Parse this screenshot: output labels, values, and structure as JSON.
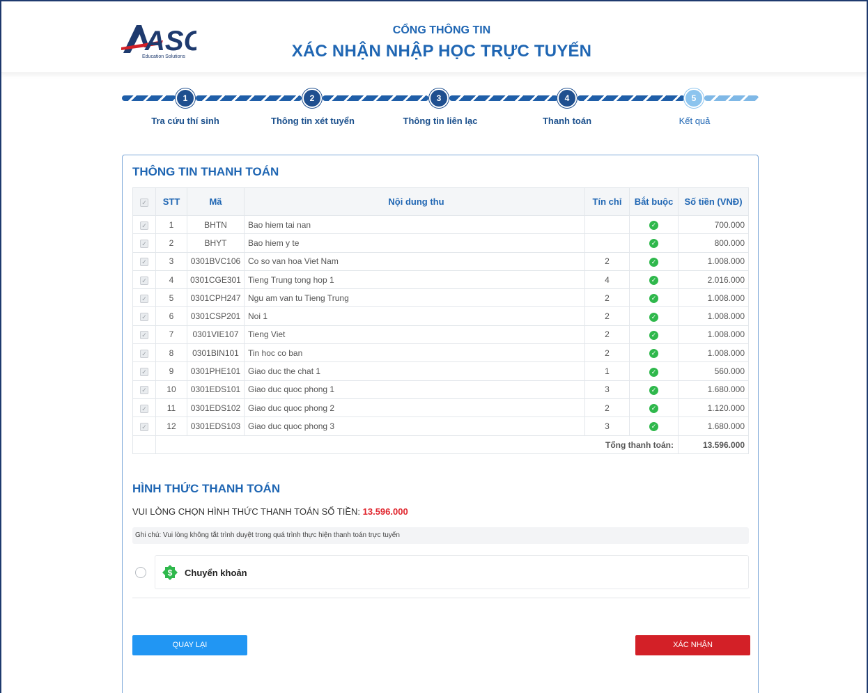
{
  "header": {
    "logo_text": "ASC",
    "logo_sub": "Education Solutions",
    "title_small": "CỔNG THÔNG TIN",
    "title_large": "XÁC NHẬN NHẬP HỌC TRỰC TUYẾN"
  },
  "steps": [
    {
      "num": "1",
      "label": "Tra cứu thí sinh",
      "state": "done"
    },
    {
      "num": "2",
      "label": "Thông tin xét tuyển",
      "state": "done"
    },
    {
      "num": "3",
      "label": "Thông tin liên lạc",
      "state": "done"
    },
    {
      "num": "4",
      "label": "Thanh toán",
      "state": "current"
    },
    {
      "num": "5",
      "label": "Kết quả",
      "state": "pending"
    }
  ],
  "payment_info": {
    "title": "THÔNG TIN THANH TOÁN",
    "columns": {
      "stt": "STT",
      "ma": "Mã",
      "noi_dung": "Nội dung thu",
      "tin_chi": "Tín chỉ",
      "bat_buoc": "Bắt buộc",
      "so_tien": "Số tiền (VNĐ)"
    },
    "rows": [
      {
        "stt": "1",
        "ma": "BHTN",
        "noi_dung": "Bao hiem tai nan",
        "tin_chi": "",
        "so_tien": "700.000"
      },
      {
        "stt": "2",
        "ma": "BHYT",
        "noi_dung": "Bao hiem y te",
        "tin_chi": "",
        "so_tien": "800.000"
      },
      {
        "stt": "3",
        "ma": "0301BVC106",
        "noi_dung": "Co so van hoa Viet Nam",
        "tin_chi": "2",
        "so_tien": "1.008.000"
      },
      {
        "stt": "4",
        "ma": "0301CGE301",
        "noi_dung": "Tieng Trung tong hop 1",
        "tin_chi": "4",
        "so_tien": "2.016.000"
      },
      {
        "stt": "5",
        "ma": "0301CPH247",
        "noi_dung": "Ngu am van tu Tieng Trung",
        "tin_chi": "2",
        "so_tien": "1.008.000"
      },
      {
        "stt": "6",
        "ma": "0301CSP201",
        "noi_dung": "Noi 1",
        "tin_chi": "2",
        "so_tien": "1.008.000"
      },
      {
        "stt": "7",
        "ma": "0301VIE107",
        "noi_dung": "Tieng Viet",
        "tin_chi": "2",
        "so_tien": "1.008.000"
      },
      {
        "stt": "8",
        "ma": "0301BIN101",
        "noi_dung": "Tin hoc co ban",
        "tin_chi": "2",
        "so_tien": "1.008.000"
      },
      {
        "stt": "9",
        "ma": "0301PHE101",
        "noi_dung": "Giao duc the chat 1",
        "tin_chi": "1",
        "so_tien": "560.000"
      },
      {
        "stt": "10",
        "ma": "0301EDS101",
        "noi_dung": "Giao duc quoc phong 1",
        "tin_chi": "3",
        "so_tien": "1.680.000"
      },
      {
        "stt": "11",
        "ma": "0301EDS102",
        "noi_dung": "Giao duc quoc phong 2",
        "tin_chi": "2",
        "so_tien": "1.120.000"
      },
      {
        "stt": "12",
        "ma": "0301EDS103",
        "noi_dung": "Giao duc quoc phong 3",
        "tin_chi": "3",
        "so_tien": "1.680.000"
      }
    ],
    "total_label": "Tổng thanh toán:",
    "total_value": "13.596.000"
  },
  "payment_method": {
    "title": "HÌNH THỨC THANH TOÁN",
    "prompt": "VUI LÒNG CHỌN HÌNH THỨC THANH TOÁN SỐ TIỀN:",
    "amount": "13.596.000",
    "note": "Ghi chú: Vui lòng không tắt trình duyệt trong quá trình thực hiện thanh toán trực tuyến",
    "option_label": "Chuyển khoản"
  },
  "buttons": {
    "back": "QUAY LẠI",
    "confirm": "XÁC NHẬN"
  },
  "colors": {
    "primary": "#1f66b3",
    "accent_blue": "#2196f3",
    "confirm_red": "#d32027",
    "total_red": "#e0262e",
    "success_green": "#2fb84c"
  }
}
